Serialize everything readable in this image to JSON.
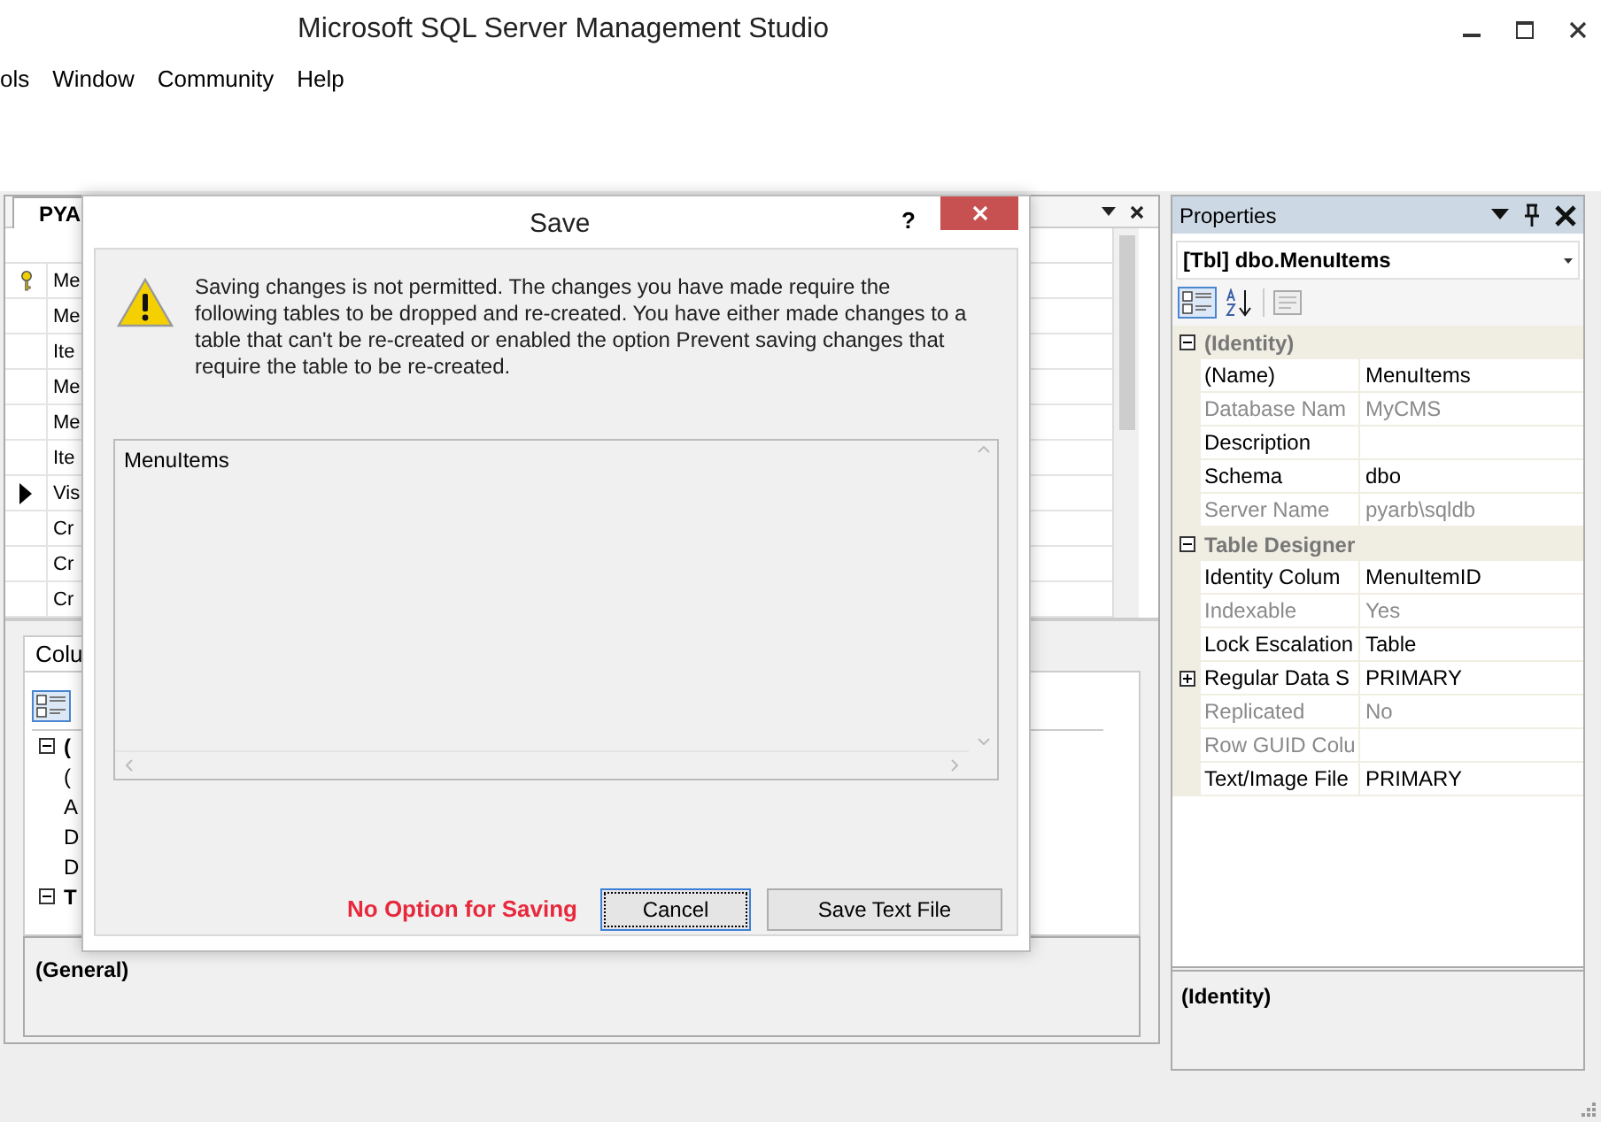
{
  "window": {
    "title": "Microsoft SQL Server Management Studio"
  },
  "menu": [
    "ols",
    "Window",
    "Community",
    "Help"
  ],
  "designer": {
    "tab": "PYA",
    "rows": [
      {
        "text": "Me",
        "primary_key": true,
        "current": false
      },
      {
        "text": "Me",
        "primary_key": false,
        "current": false
      },
      {
        "text": "Ite",
        "primary_key": false,
        "current": false
      },
      {
        "text": "Me",
        "primary_key": false,
        "current": false
      },
      {
        "text": "Me",
        "primary_key": false,
        "current": false
      },
      {
        "text": "Ite",
        "primary_key": false,
        "current": false
      },
      {
        "text": "Vis",
        "primary_key": false,
        "current": true
      },
      {
        "text": "Cr",
        "primary_key": false,
        "current": false
      },
      {
        "text": "Cr",
        "primary_key": false,
        "current": false
      },
      {
        "text": "Cr",
        "primary_key": false,
        "current": false
      }
    ]
  },
  "column_properties": {
    "tab": "Colu",
    "rows": [
      {
        "kind": "category",
        "text": "(",
        "expanded": true
      },
      {
        "kind": "item",
        "text": "("
      },
      {
        "kind": "item",
        "text": "A"
      },
      {
        "kind": "item",
        "text": "D"
      },
      {
        "kind": "item",
        "text": "D"
      },
      {
        "kind": "category",
        "text": "T",
        "expanded": true
      }
    ],
    "description": "(General)"
  },
  "properties": {
    "title": "Properties",
    "object": "[Tbl] dbo.MenuItems",
    "groups": [
      {
        "name": "(Identity)",
        "expanded": true,
        "items": [
          {
            "name": "(Name)",
            "value": "MenuItems",
            "disabled": false,
            "expandable": false
          },
          {
            "name": "Database Nam",
            "value": "MyCMS",
            "disabled": true,
            "expandable": false
          },
          {
            "name": "Description",
            "disabled": false,
            "expandable": false
          },
          {
            "name": "Schema",
            "value": "dbo",
            "disabled": false,
            "expandable": false
          },
          {
            "name": "Server Name",
            "value": "pyarb\\sqldb",
            "disabled": true,
            "expandable": false
          }
        ]
      },
      {
        "name": "Table Designer",
        "expanded": true,
        "items": [
          {
            "name": "Identity Colum",
            "value": "MenuItemID",
            "disabled": false,
            "expandable": false
          },
          {
            "name": "Indexable",
            "value": "Yes",
            "disabled": true,
            "expandable": false
          },
          {
            "name": "Lock Escalation",
            "value": "Table",
            "disabled": false,
            "expandable": false
          },
          {
            "name": "Regular Data S",
            "value": "PRIMARY",
            "disabled": false,
            "expandable": true
          },
          {
            "name": "Replicated",
            "value": "No",
            "disabled": true,
            "expandable": false
          },
          {
            "name": "Row GUID Colu",
            "disabled": true,
            "expandable": false
          },
          {
            "name": "Text/Image File",
            "value": "PRIMARY",
            "disabled": false,
            "expandable": false
          }
        ]
      }
    ],
    "description": "(Identity)"
  },
  "dialog": {
    "title": "Save",
    "help": "?",
    "message": "Saving changes is not permitted. The changes you have made require the following tables to be dropped and re-created. You have either made changes to a table that can't be re-created or enabled the option Prevent saving changes that require the table to be re-created.",
    "list": [
      "MenuItems"
    ],
    "note": "No Option for Saving",
    "buttons": [
      {
        "label": "Cancel",
        "focused": true
      },
      {
        "label": "Save Text File",
        "focused": false
      }
    ]
  }
}
